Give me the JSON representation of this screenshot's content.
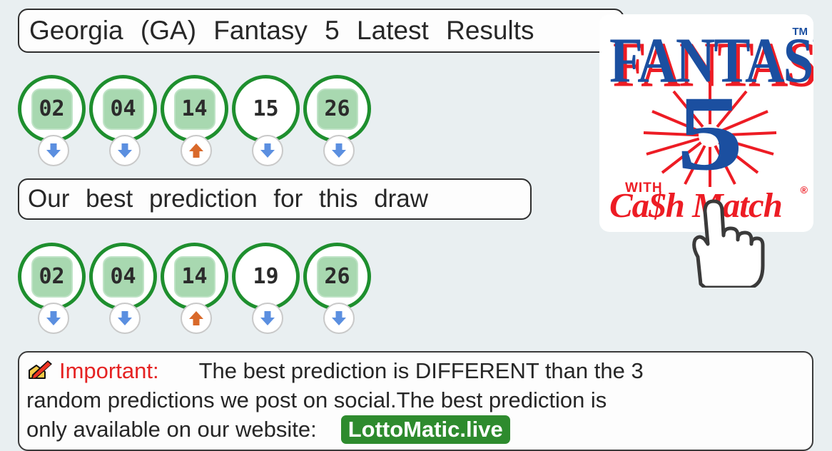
{
  "page": {
    "background_color": "#e9eff1",
    "title": "Georgia   (GA)  Fantasy   5 Latest   Results"
  },
  "header": {
    "title": "Georgia   (GA)  Fantasy   5 Latest   Results"
  },
  "logo": {
    "word": "FANTASY",
    "trademark": "TM",
    "number": "5",
    "with_label": "WITH",
    "cash_match": "Ca$h Match",
    "registered": "®",
    "blue": "#1b4fa0",
    "red": "#ed1c24"
  },
  "latest_results": {
    "label": "Georgia   (GA)  Fantasy   5 Latest   Results",
    "balls": [
      {
        "number": "02",
        "highlighted": true,
        "trend": "down"
      },
      {
        "number": "04",
        "highlighted": true,
        "trend": "down"
      },
      {
        "number": "14",
        "highlighted": true,
        "trend": "up"
      },
      {
        "number": "15",
        "highlighted": false,
        "trend": "down"
      },
      {
        "number": "26",
        "highlighted": true,
        "trend": "down"
      }
    ]
  },
  "prediction": {
    "heading": "Our   best   prediction     for  this   draw",
    "balls": [
      {
        "number": "02",
        "highlighted": true,
        "trend": "down"
      },
      {
        "number": "04",
        "highlighted": true,
        "trend": "down"
      },
      {
        "number": "14",
        "highlighted": true,
        "trend": "up"
      },
      {
        "number": "19",
        "highlighted": false,
        "trend": "down"
      },
      {
        "number": "26",
        "highlighted": true,
        "trend": "down"
      }
    ]
  },
  "footer": {
    "icon": "writing-hand-icon",
    "important_label": "Important:",
    "line1_rest": "The    best    prediction     is DIFFERENT       than   the   3",
    "line2": "random     predictions       we  post   on  social.The       best   prediction       is",
    "line3_prefix": "only   available      on  our  website:",
    "brand": "LottoMatic.live"
  },
  "colors": {
    "ball_ring": "#1e8f2e",
    "chip_green": "#a8d8b0",
    "arrow_down": "#5b8fe0",
    "arrow_up": "#d9692a",
    "brand_badge": "#2e8b2e",
    "important_red": "#e52222"
  }
}
